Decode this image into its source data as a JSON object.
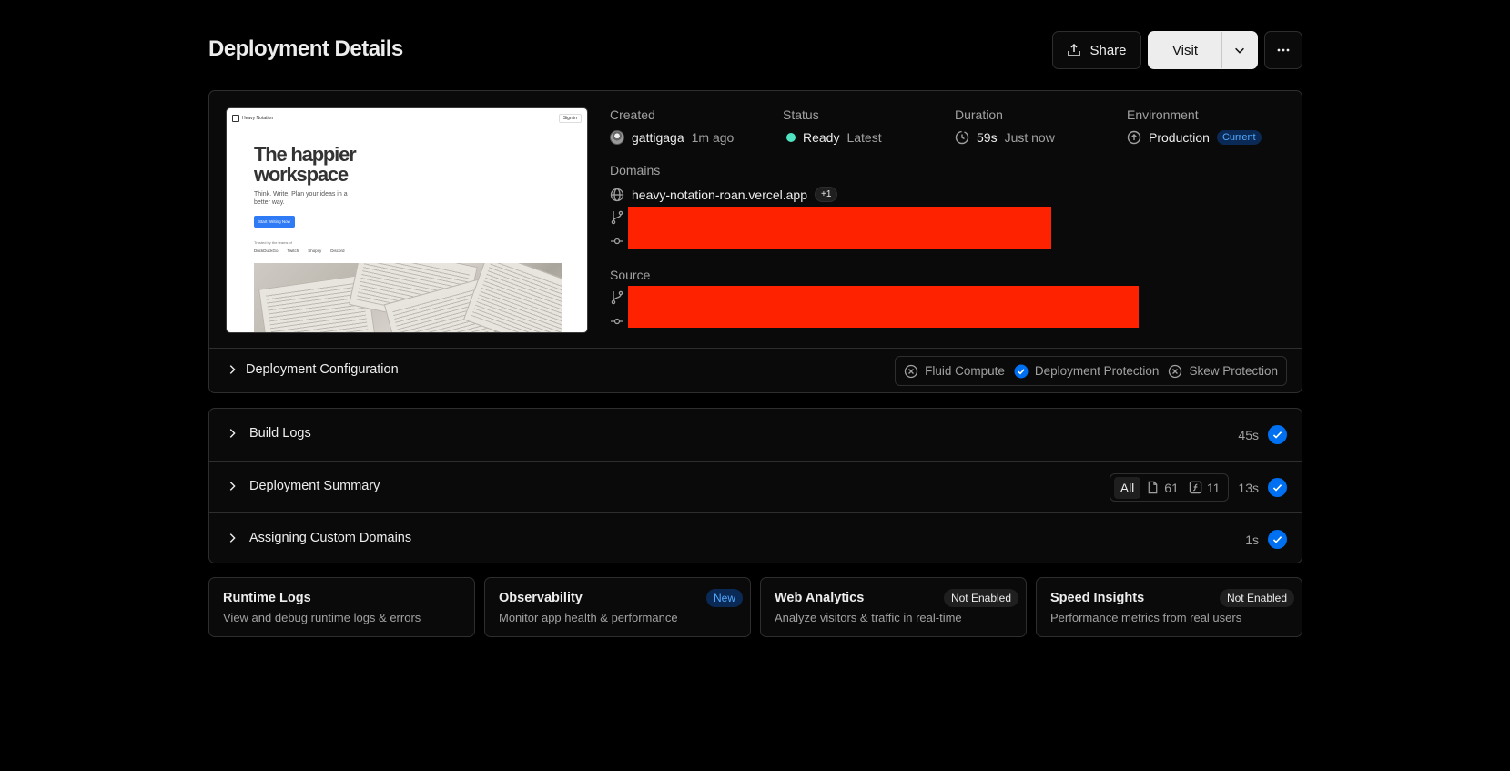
{
  "page": {
    "title": "Deployment Details"
  },
  "header": {
    "share_label": "Share",
    "visit_label": "Visit",
    "more_icon": "ellipsis-icon"
  },
  "preview": {
    "brand": "Heavy Notation",
    "signin": "Sign in",
    "headline": "The happier workspace",
    "subtitle": "Think. Write. Plan your ideas in a better way.",
    "cta": "Start Writing Now",
    "trusted": "Trusted by the teams of",
    "logos": [
      "DuckDuckGo",
      "Twitch",
      "Shopify",
      "Discord"
    ]
  },
  "meta": {
    "created_label": "Created",
    "created_user": "gattigaga",
    "created_time": "1m ago",
    "status_label": "Status",
    "status_value": "Ready",
    "status_tag": "Latest",
    "status_color": "#50e3c2",
    "duration_label": "Duration",
    "duration_value": "59s",
    "duration_when": "Just now",
    "environment_label": "Environment",
    "environment_value": "Production",
    "environment_badge": "Current",
    "domains_label": "Domains",
    "domain": "heavy-notation-roan.vercel.app",
    "domain_extra": "+1",
    "source_label": "Source",
    "redaction_color": "#ff2200"
  },
  "config": {
    "title": "Deployment Configuration",
    "features": [
      {
        "label": "Fluid Compute",
        "enabled": false
      },
      {
        "label": "Deployment Protection",
        "enabled": true
      },
      {
        "label": "Skew Protection",
        "enabled": false
      }
    ]
  },
  "steps": [
    {
      "title": "Build Logs",
      "duration": "45s"
    },
    {
      "title": "Deployment Summary",
      "duration": "13s",
      "filter": {
        "all": "All",
        "files": "61",
        "functions": "11"
      }
    },
    {
      "title": "Assigning Custom Domains",
      "duration": "1s"
    }
  ],
  "tiles": [
    {
      "title": "Runtime Logs",
      "desc": "View and debug runtime logs & errors",
      "badge": ""
    },
    {
      "title": "Observability",
      "desc": "Monitor app health & performance",
      "badge": "New"
    },
    {
      "title": "Web Analytics",
      "desc": "Analyze visitors & traffic in real-time",
      "badge": "Not Enabled"
    },
    {
      "title": "Speed Insights",
      "desc": "Performance metrics from real users",
      "badge": "Not Enabled"
    }
  ],
  "colors": {
    "accent": "#0070f3",
    "background": "#000000",
    "card": "#0a0a0a",
    "border": "#2e2e2e"
  }
}
